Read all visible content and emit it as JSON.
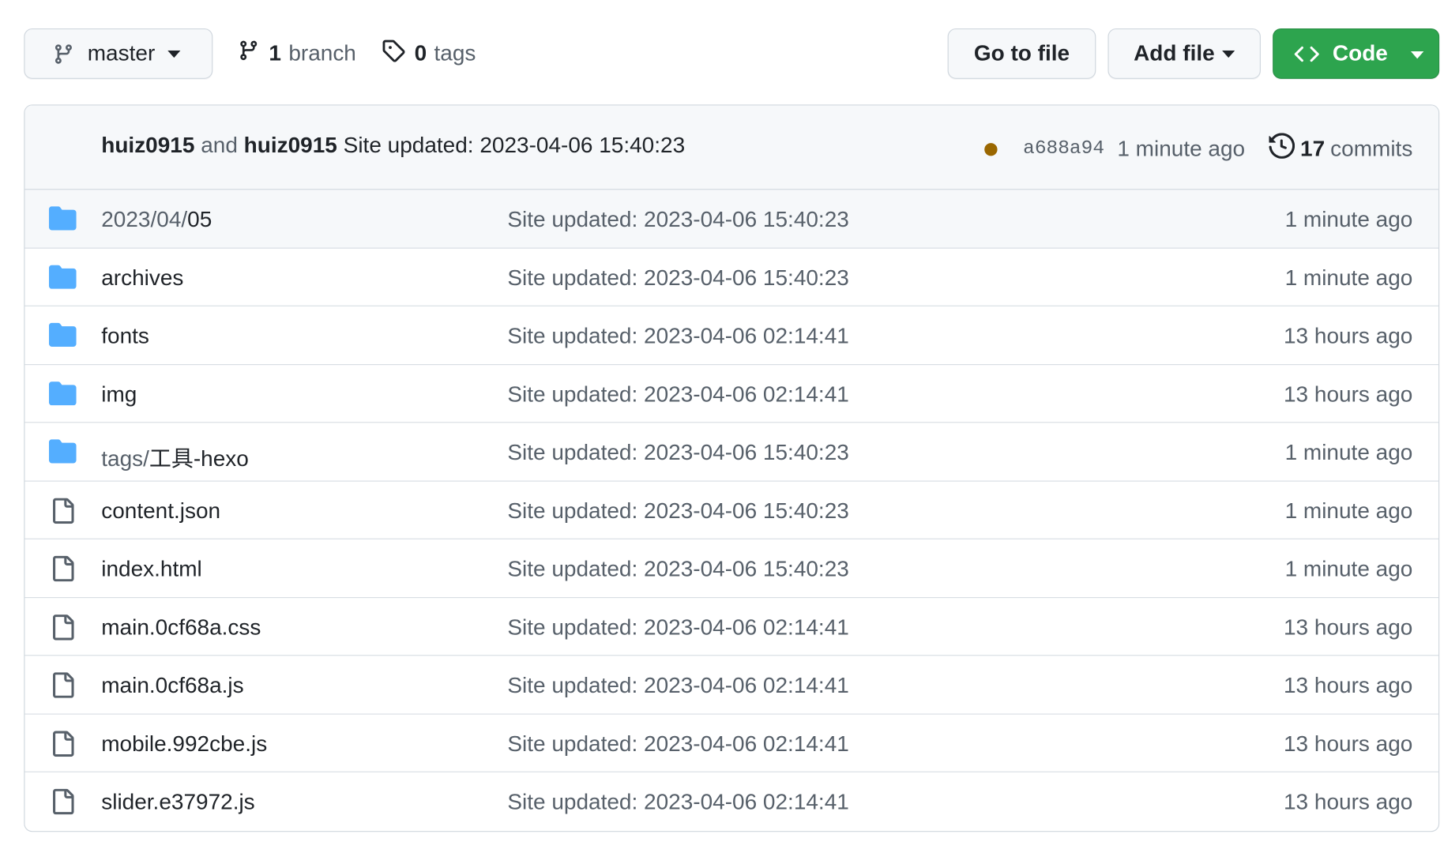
{
  "toolbar": {
    "branch_name": "master",
    "branches_count": "1",
    "branches_label": "branch",
    "tags_count": "0",
    "tags_label": "tags",
    "goto_file_label": "Go to file",
    "add_file_label": "Add file",
    "code_label": "Code",
    "code_button_color": "#2da44e"
  },
  "commit": {
    "author": "huiz0915",
    "and_text": "and",
    "committer": "huiz0915",
    "message": "Site updated: 2023-04-06 15:40:23",
    "status_color": "#9a6700",
    "sha": "a688a94",
    "age": "1 minute ago",
    "commits_count": "17",
    "commits_label": "commits"
  },
  "files": [
    {
      "type": "folder",
      "prefix": "2023/04/",
      "name": "05",
      "message": "Site updated: 2023-04-06 15:40:23",
      "time": "1 minute ago"
    },
    {
      "type": "folder",
      "prefix": "",
      "name": "archives",
      "message": "Site updated: 2023-04-06 15:40:23",
      "time": "1 minute ago"
    },
    {
      "type": "folder",
      "prefix": "",
      "name": "fonts",
      "message": "Site updated: 2023-04-06 02:14:41",
      "time": "13 hours ago"
    },
    {
      "type": "folder",
      "prefix": "",
      "name": "img",
      "message": "Site updated: 2023-04-06 02:14:41",
      "time": "13 hours ago"
    },
    {
      "type": "folder",
      "prefix": "tags/",
      "name": "工具-hexo",
      "message": "Site updated: 2023-04-06 15:40:23",
      "time": "1 minute ago"
    },
    {
      "type": "file",
      "prefix": "",
      "name": "content.json",
      "message": "Site updated: 2023-04-06 15:40:23",
      "time": "1 minute ago"
    },
    {
      "type": "file",
      "prefix": "",
      "name": "index.html",
      "message": "Site updated: 2023-04-06 15:40:23",
      "time": "1 minute ago"
    },
    {
      "type": "file",
      "prefix": "",
      "name": "main.0cf68a.css",
      "message": "Site updated: 2023-04-06 02:14:41",
      "time": "13 hours ago"
    },
    {
      "type": "file",
      "prefix": "",
      "name": "main.0cf68a.js",
      "message": "Site updated: 2023-04-06 02:14:41",
      "time": "13 hours ago"
    },
    {
      "type": "file",
      "prefix": "",
      "name": "mobile.992cbe.js",
      "message": "Site updated: 2023-04-06 02:14:41",
      "time": "13 hours ago"
    },
    {
      "type": "file",
      "prefix": "",
      "name": "slider.e37972.js",
      "message": "Site updated: 2023-04-06 02:14:41",
      "time": "13 hours ago"
    }
  ],
  "icons": {
    "folder_color": "#54aeff",
    "file_color": "#57606a"
  }
}
